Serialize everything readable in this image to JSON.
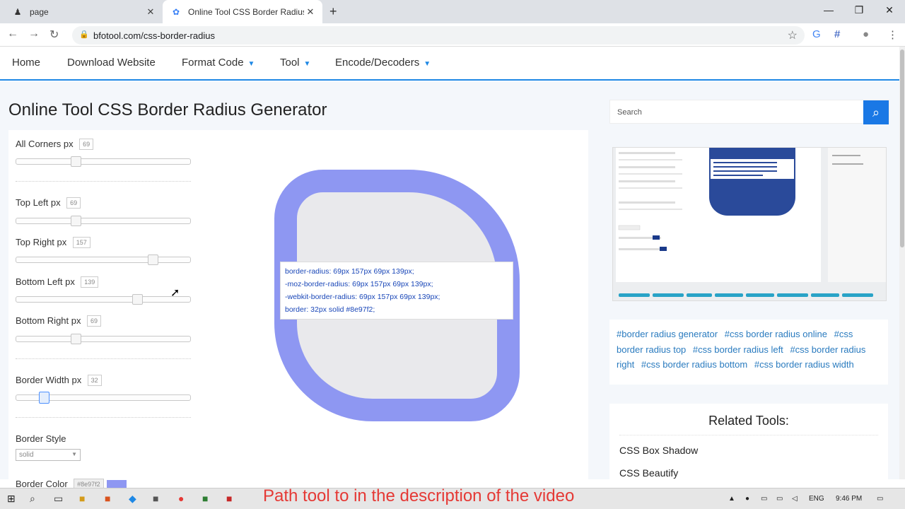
{
  "browser": {
    "tabs": [
      {
        "title": "page",
        "active": false
      },
      {
        "title": "Online Tool CSS Border Radius G",
        "active": true
      }
    ],
    "url": "bfotool.com/css-border-radius"
  },
  "nav": {
    "items": [
      "Home",
      "Download Website",
      "Format Code",
      "Tool",
      "Encode/Decoders"
    ]
  },
  "page": {
    "title": "Online Tool CSS Border Radius Generator"
  },
  "controls": {
    "all_corners": {
      "label": "All Corners  px",
      "value": "69"
    },
    "top_left": {
      "label": "Top Left  px",
      "value": "69"
    },
    "top_right": {
      "label": "Top Right  px",
      "value": "157"
    },
    "bottom_left": {
      "label": "Bottom Left  px",
      "value": "139"
    },
    "bottom_right": {
      "label": "Bottom Right  px",
      "value": "69"
    },
    "border_width": {
      "label": "Border Width  px",
      "value": "32"
    },
    "border_style": {
      "label": "Border Style",
      "value": "solid"
    },
    "border_color": {
      "label": "Border Color",
      "value": "#8e97f2"
    }
  },
  "code": [
    "border-radius: 69px 157px 69px 139px;",
    "-moz-border-radius: 69px 157px 69px 139px;",
    "-webkit-border-radius: 69px 157px 69px 139px;",
    "border: 32px solid #8e97f2;"
  ],
  "sidebar": {
    "search_placeholder": "Search",
    "tags": [
      "#border radius generator",
      "#css border radius online",
      "#css border radius top",
      "#css border radius left",
      "#css border radius right",
      "#css border radius bottom",
      "#css border radius width"
    ],
    "related_title": "Related Tools:",
    "related": [
      "CSS Box Shadow",
      "CSS Beautify"
    ]
  },
  "overlay": {
    "banner": "Path tool to in the description of the video"
  },
  "taskbar": {
    "lang": "ENG",
    "time": "9:46 PM"
  },
  "colors": {
    "accent": "#1e88e5",
    "border": "#8e97f2",
    "banner": "#e53935"
  }
}
